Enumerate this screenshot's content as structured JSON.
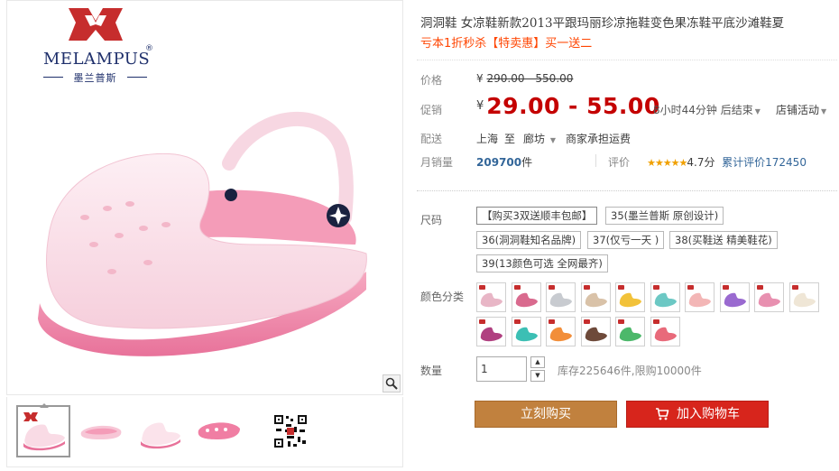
{
  "brand": {
    "logo_text": "MELAMPUS",
    "logo_reg": "®",
    "logo_cn": "墨兰普斯",
    "colors": {
      "logo_red": "#c62d2d",
      "logo_navy": "#1e2f6b"
    }
  },
  "gallery": {
    "zoom_icon": "magnifier-icon",
    "thumbnails": [
      "shoe-side-pink",
      "shoe-top-pink",
      "shoe-side-pink-2",
      "shoe-sole-pink",
      "qr-code"
    ]
  },
  "product": {
    "title": "洞洞鞋 女凉鞋新款2013平跟玛丽珍凉拖鞋变色果冻鞋平底沙滩鞋夏",
    "subtitle": "亏本1折秒杀【特卖惠】买一送二"
  },
  "price": {
    "label": "价格",
    "currency": "¥",
    "original": "290.00 - 550.00",
    "promo_label": "促销",
    "promo": "29.00 - 55.00",
    "countdown": "8小时44分钟 后结束",
    "shop_activity": "店铺活动",
    "accent_color": "#c40000"
  },
  "shipping": {
    "label": "配送",
    "from": "上海",
    "to_word": "至",
    "to": "廊坊",
    "note": "商家承担运费"
  },
  "stats": {
    "sales_label": "月销量",
    "sales": "209700",
    "sales_unit": "件",
    "rating_label": "评价",
    "stars": "★★★★★",
    "score": "4.7分",
    "review_count": "累计评价172450"
  },
  "sku": {
    "size_label": "尺码",
    "sizes": [
      "【购买3双送顺丰包邮】",
      "35(墨兰普斯 原创设计)",
      "36(洞洞鞋知名品牌)",
      "37(仅亏一天 )",
      "38(买鞋送 精美鞋花)",
      "39(13颜色可选 全网最齐)"
    ],
    "color_label": "颜色分类",
    "swatch_colors": [
      "#e8b6c6",
      "#d96a8e",
      "#c8cbd0",
      "#d9c2a8",
      "#f2c23a",
      "#6cc8c4",
      "#f3b6b6",
      "#9a6ad0",
      "#e890b0",
      "#efe6d6",
      "#b04080",
      "#3cbfb4",
      "#f28e3a",
      "#6e4a3a",
      "#4cb86a",
      "#e86a7a"
    ]
  },
  "quantity": {
    "label": "数量",
    "value": "1",
    "up": "▲",
    "down": "▼",
    "stock": "库存225646件,限购10000件"
  },
  "actions": {
    "buy_now": "立刻购买",
    "add_cart": "加入购物车"
  }
}
